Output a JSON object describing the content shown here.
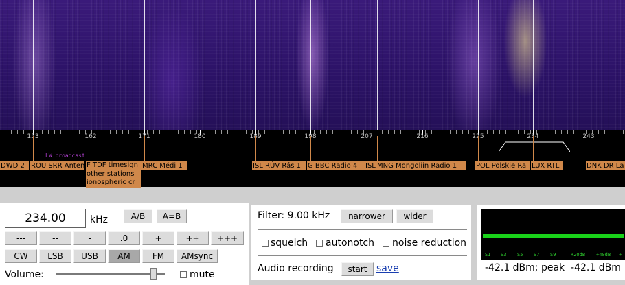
{
  "scale": {
    "ticks": [
      {
        "label": "153"
      },
      {
        "label": "162"
      },
      {
        "label": "171"
      },
      {
        "label": "180"
      },
      {
        "label": "189"
      },
      {
        "label": "198"
      },
      {
        "label": "207"
      },
      {
        "label": "216"
      },
      {
        "label": "225"
      },
      {
        "label": "234"
      },
      {
        "label": "243"
      }
    ],
    "band_label": "LW broadcast"
  },
  "stations": [
    {
      "label": "DWD 2"
    },
    {
      "label": "ROU SRR Antena"
    },
    {
      "label": "F TDF timesign\nother stations\nionospheric cr"
    },
    {
      "label": "MRC Médi 1"
    },
    {
      "label": "ISL RÚV Rás 1"
    },
    {
      "label": "G BBC Radio 4"
    },
    {
      "label": "ISL"
    },
    {
      "label": "MNG Mongoliin Radio 1"
    },
    {
      "label": "POL Polskie Ra"
    },
    {
      "label": "LUX RTL"
    },
    {
      "label": "DNK DR La"
    }
  ],
  "frequency": {
    "value": "234.00",
    "unit": "kHz"
  },
  "buttons": {
    "ab": "A/B",
    "aeqb": "A=B",
    "steps": [
      "---",
      "--",
      "-",
      ".0",
      "+",
      "++",
      "+++"
    ],
    "modes": [
      "CW",
      "LSB",
      "USB",
      "AM",
      "FM",
      "AMsync"
    ],
    "active_mode": "AM"
  },
  "volume": {
    "label": "Volume:",
    "level": 0.89,
    "mute_label": "mute"
  },
  "filter": {
    "label": "Filter: 9.00 kHz",
    "narrower": "narrower",
    "wider": "wider",
    "squelch": "squelch",
    "autonotch": "autonotch",
    "noise_reduction": "noise reduction",
    "recording_label": "Audio recording",
    "start": "start",
    "save": "save"
  },
  "smeter": {
    "labels": [
      "S1",
      "S3",
      "S5",
      "S7",
      "S9",
      "+20dB",
      "+40dB",
      "+"
    ],
    "readout": "-42.1 dBm; peak  -42.1 dBm"
  },
  "colors": {
    "station_bg": "#d0884a",
    "band": "#a020c0",
    "meter": "#1ad21a"
  }
}
